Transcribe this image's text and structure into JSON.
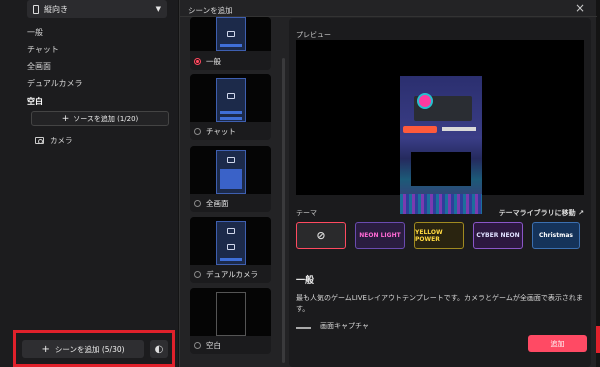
{
  "sidebar": {
    "orientation_label": "縦向き",
    "scenes": [
      "一般",
      "チャット",
      "全画面",
      "デュアルカメラ",
      "空白"
    ],
    "active_scene": "空白",
    "add_source_label": "ソースを追加 (1/20)",
    "source_item": "カメラ",
    "add_scene_label": "シーンを追加 (5/30)"
  },
  "dialog": {
    "title": "シーンを追加",
    "templates": [
      {
        "label": "一般",
        "selected": true
      },
      {
        "label": "チャット",
        "selected": false
      },
      {
        "label": "全画面",
        "selected": false
      },
      {
        "label": "デュアルカメラ",
        "selected": false
      },
      {
        "label": "空白",
        "selected": false
      }
    ],
    "preview_label": "プレビュー",
    "theme_label": "テーマ",
    "theme_library_label": "テーマライブラリに移動",
    "themes": [
      "NEON LIGHT",
      "YELLOW POWER",
      "CYBER NEON",
      "Christmas"
    ],
    "section_title": "一般",
    "description": "最も人気のゲームLIVEレイアウトテンプレートです。カメラとゲームが全画面で表示されます。",
    "capture_label": "画面キャプチャ",
    "add_button": "追加"
  },
  "colors": {
    "accent": "#ff4a64",
    "highlight_box": "#e0212b"
  }
}
